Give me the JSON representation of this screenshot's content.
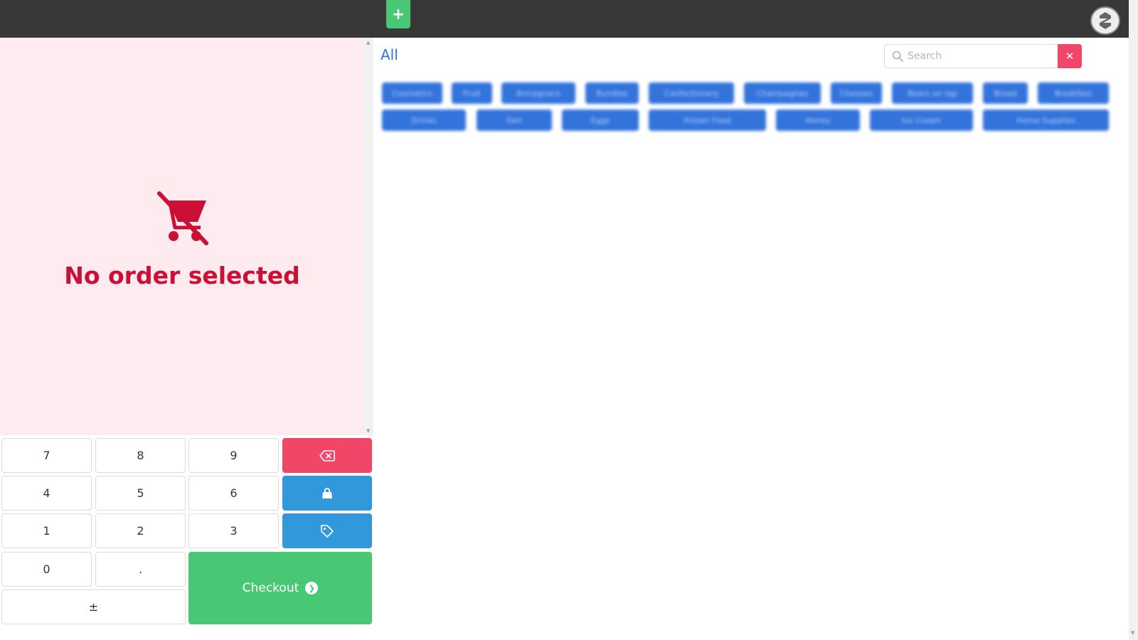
{
  "topbar": {
    "add_label": "+",
    "logo": "app-logo-icon"
  },
  "order": {
    "empty_icon": "cart-off-icon",
    "empty_text": "No order selected"
  },
  "keypad": {
    "keys": [
      "7",
      "8",
      "9",
      "4",
      "5",
      "6",
      "1",
      "2",
      "3",
      "0",
      ".",
      "±"
    ],
    "backspace_icon": "backspace-icon",
    "lock_icon": "bag-icon",
    "discount_icon": "tag-icon",
    "checkout_label": "Checkout",
    "checkout_icon": "arrow-right-circle-icon"
  },
  "products": {
    "filter_label": "All",
    "search_placeholder": "Search",
    "clear_label": "✕",
    "categories": [
      "Cosmetics",
      "Fruit",
      "Armagnacs",
      "Bundles",
      "Confectionery",
      "Champagnes",
      "Cheeses",
      "Beers on tap",
      "Bread",
      "Breakfast",
      "Drinks",
      "Deli",
      "Eggs",
      "Frozen Food",
      "Honey",
      "Ice Cream",
      "Home Supplies"
    ]
  },
  "colors": {
    "danger": "#f14668",
    "success": "#48c774",
    "info": "#3298dc",
    "link": "#3273dc",
    "empty": "#cc0f35"
  }
}
